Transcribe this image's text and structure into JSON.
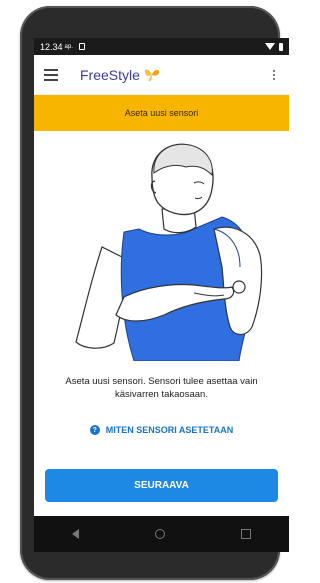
{
  "status_bar": {
    "time": "12.34",
    "ampm": "ap."
  },
  "app_bar": {
    "brand": "FreeStyle"
  },
  "banner": {
    "title": "Aseta uusi sensori"
  },
  "content": {
    "instruction": "Aseta uusi sensori. Sensori tulee asettaa vain käsivarren takaosaan.",
    "help_link": "MITEN SENSORI ASETETAAN",
    "help_icon_text": "?",
    "next_button": "SEURAAVA"
  },
  "colors": {
    "banner": "#f7b500",
    "accent": "#1e88e5",
    "shirt": "#2f6fe0",
    "brand": "#3a3f9a"
  },
  "icons": [
    "menu-icon",
    "butterfly-logo-icon",
    "more-vert-icon",
    "help-icon",
    "wifi-icon",
    "battery-icon",
    "back-nav-icon",
    "home-nav-icon",
    "recents-nav-icon"
  ]
}
